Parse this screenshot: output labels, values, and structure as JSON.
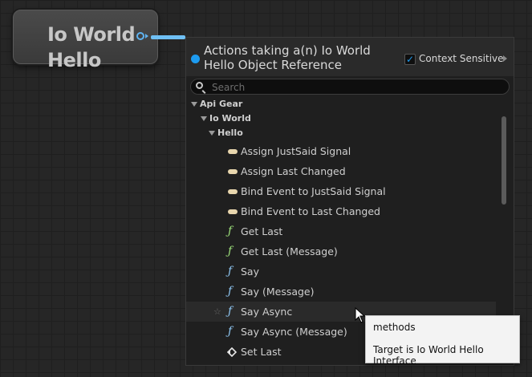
{
  "node": {
    "title": "Io World Hello"
  },
  "menu": {
    "title": "Actions taking a(n) Io World Hello Object Reference",
    "context_sensitive_label": "Context Sensitive",
    "context_sensitive_checked": true,
    "search": {
      "placeholder": "Search",
      "value": ""
    },
    "categories": [
      {
        "label": "Api Gear"
      },
      {
        "label": "Io World"
      },
      {
        "label": "Hello"
      }
    ],
    "items": [
      {
        "label": "Assign JustSaid Signal",
        "icon": "event-icon"
      },
      {
        "label": "Assign Last Changed",
        "icon": "event-icon"
      },
      {
        "label": "Bind Event to JustSaid Signal",
        "icon": "event-icon"
      },
      {
        "label": "Bind Event to Last Changed",
        "icon": "event-icon"
      },
      {
        "label": "Get Last",
        "icon": "function-pure-icon"
      },
      {
        "label": "Get Last (Message)",
        "icon": "function-pure-icon"
      },
      {
        "label": "Say",
        "icon": "function-icon"
      },
      {
        "label": "Say (Message)",
        "icon": "function-icon"
      },
      {
        "label": "Say Async",
        "icon": "function-icon",
        "hovered": true
      },
      {
        "label": "Say Async (Message)",
        "icon": "function-icon"
      },
      {
        "label": "Set Last",
        "icon": "set-variable-icon"
      }
    ]
  },
  "tooltip": {
    "line1": "methods",
    "line2": "Target is Io World Hello Interface"
  },
  "colors": {
    "accent": "#1d9bf0",
    "wire": "#6fc0f5",
    "event": "#e8d6ad",
    "pure_function": "#9ee27b",
    "function": "#8fc7f3"
  }
}
